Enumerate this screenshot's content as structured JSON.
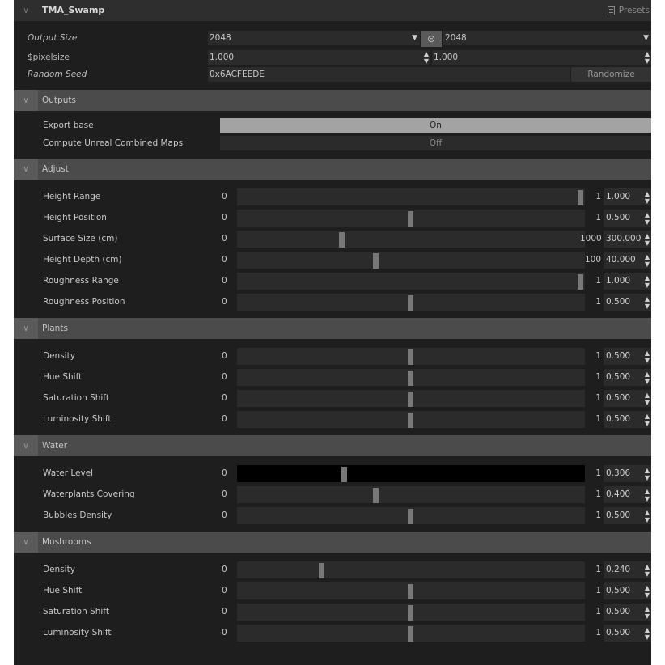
{
  "header": {
    "title": "TMA_Swamp",
    "presets_label": "Presets"
  },
  "top_params": {
    "output_size": {
      "label": "Output Size",
      "width_value": "2048",
      "height_value": "2048"
    },
    "pixelsize": {
      "label": "$pixelsize",
      "value_x": "1.000",
      "value_y": "1.000"
    },
    "random_seed": {
      "label": "Random Seed",
      "value": "0x6ACFEEDE",
      "button_label": "Randomize"
    }
  },
  "outputs": {
    "title": "Outputs",
    "items": [
      {
        "label": "Export base",
        "value": "On"
      },
      {
        "label": "Compute Unreal Combined Maps",
        "value": "Off"
      }
    ]
  },
  "adjust": {
    "title": "Adjust",
    "sliders": [
      {
        "label": "Height Range",
        "min": "0",
        "max": "1",
        "value": "1.000",
        "fraction": 1.0
      },
      {
        "label": "Height Position",
        "min": "0",
        "max": "1",
        "value": "0.500",
        "fraction": 0.5
      },
      {
        "label": "Surface Size (cm)",
        "min": "0",
        "max": "1000",
        "value": "300.000",
        "fraction": 0.3
      },
      {
        "label": "Height Depth (cm)",
        "min": "0",
        "max": "100",
        "value": "40.000",
        "fraction": 0.4
      },
      {
        "label": "Roughness Range",
        "min": "0",
        "max": "1",
        "value": "1.000",
        "fraction": 1.0
      },
      {
        "label": "Roughness Position",
        "min": "0",
        "max": "1",
        "value": "0.500",
        "fraction": 0.5
      }
    ]
  },
  "plants": {
    "title": "Plants",
    "sliders": [
      {
        "label": "Density",
        "min": "0",
        "max": "1",
        "value": "0.500",
        "fraction": 0.5
      },
      {
        "label": "Hue Shift",
        "min": "0",
        "max": "1",
        "value": "0.500",
        "fraction": 0.5
      },
      {
        "label": "Saturation Shift",
        "min": "0",
        "max": "1",
        "value": "0.500",
        "fraction": 0.5
      },
      {
        "label": "Luminosity Shift",
        "min": "0",
        "max": "1",
        "value": "0.500",
        "fraction": 0.5
      }
    ]
  },
  "water": {
    "title": "Water",
    "sliders": [
      {
        "label": "Water Level",
        "min": "0",
        "max": "1",
        "value": "0.306",
        "fraction": 0.306
      },
      {
        "label": "Waterplants Covering",
        "min": "0",
        "max": "1",
        "value": "0.400",
        "fraction": 0.4
      },
      {
        "label": "Bubbles Density",
        "min": "0",
        "max": "1",
        "value": "0.500",
        "fraction": 0.5
      }
    ]
  },
  "mushrooms": {
    "title": "Mushrooms",
    "sliders": [
      {
        "label": "Density",
        "min": "0",
        "max": "1",
        "value": "0.240",
        "fraction": 0.24
      },
      {
        "label": "Hue Shift",
        "min": "0",
        "max": "1",
        "value": "0.500",
        "fraction": 0.5
      },
      {
        "label": "Saturation Shift",
        "min": "0",
        "max": "1",
        "value": "0.500",
        "fraction": 0.5
      },
      {
        "label": "Luminosity Shift",
        "min": "0",
        "max": "1",
        "value": "0.500",
        "fraction": 0.5
      }
    ]
  },
  "colors": {
    "panel_bg": "#1e1e1e",
    "section_header": "#4b4b4b",
    "field_bg": "#2b2b2b",
    "handle": "#787878",
    "toggle_on": "#a3a3a3"
  }
}
